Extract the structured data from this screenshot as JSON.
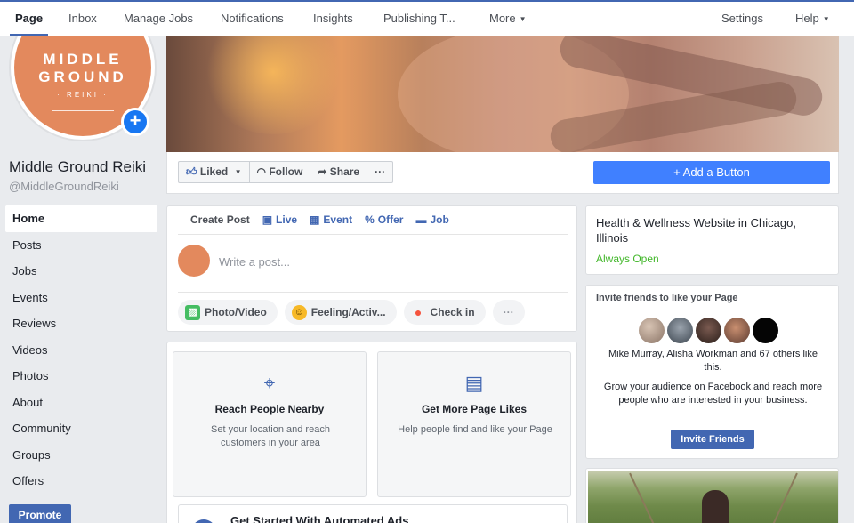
{
  "nav": {
    "tabs": [
      "Page",
      "Inbox",
      "Manage Jobs",
      "Notifications",
      "Insights",
      "Publishing T...",
      "More"
    ],
    "right": [
      "Settings",
      "Help"
    ]
  },
  "profile": {
    "logo_line1": "MIDDLE",
    "logo_line2": "GROUND",
    "logo_line3": "· REIKI ·",
    "name": "Middle Ground Reiki",
    "handle": "@MiddleGroundReiki"
  },
  "sidebar": {
    "items": [
      "Home",
      "Posts",
      "Jobs",
      "Events",
      "Reviews",
      "Videos",
      "Photos",
      "About",
      "Community",
      "Groups",
      "Offers"
    ],
    "promote": "Promote"
  },
  "actions": {
    "liked": "Liked",
    "follow": "Follow",
    "share": "Share",
    "more": "···",
    "add_button": "+ Add a Button"
  },
  "composer": {
    "tabs": [
      "Create Post",
      "Live",
      "Event",
      "Offer",
      "Job"
    ],
    "placeholder": "Write a post...",
    "pills": [
      "Photo/Video",
      "Feeling/Activ...",
      "Check in",
      "···"
    ]
  },
  "promos": {
    "card1_title": "Reach People Nearby",
    "card1_desc": "Set your location and reach customers in your area",
    "card2_title": "Get More Page Likes",
    "card2_desc": "Help people find and like your Page",
    "autoads_title": "Get Started With Automated Ads"
  },
  "info": {
    "category": "Health & Wellness Website in Chicago, Illinois",
    "hours": "Always Open"
  },
  "invite": {
    "title": "Invite friends to like your Page",
    "liked_by": "Mike Murray, Alisha Workman and 67 others like this.",
    "grow": "Grow your audience on Facebook and reach more people who are interested in your business.",
    "button": "Invite Friends"
  },
  "colors": {
    "brand": "#4267b2",
    "cta": "#4080ff",
    "open_green": "#42b72a",
    "logo_orange": "#e3895d"
  }
}
